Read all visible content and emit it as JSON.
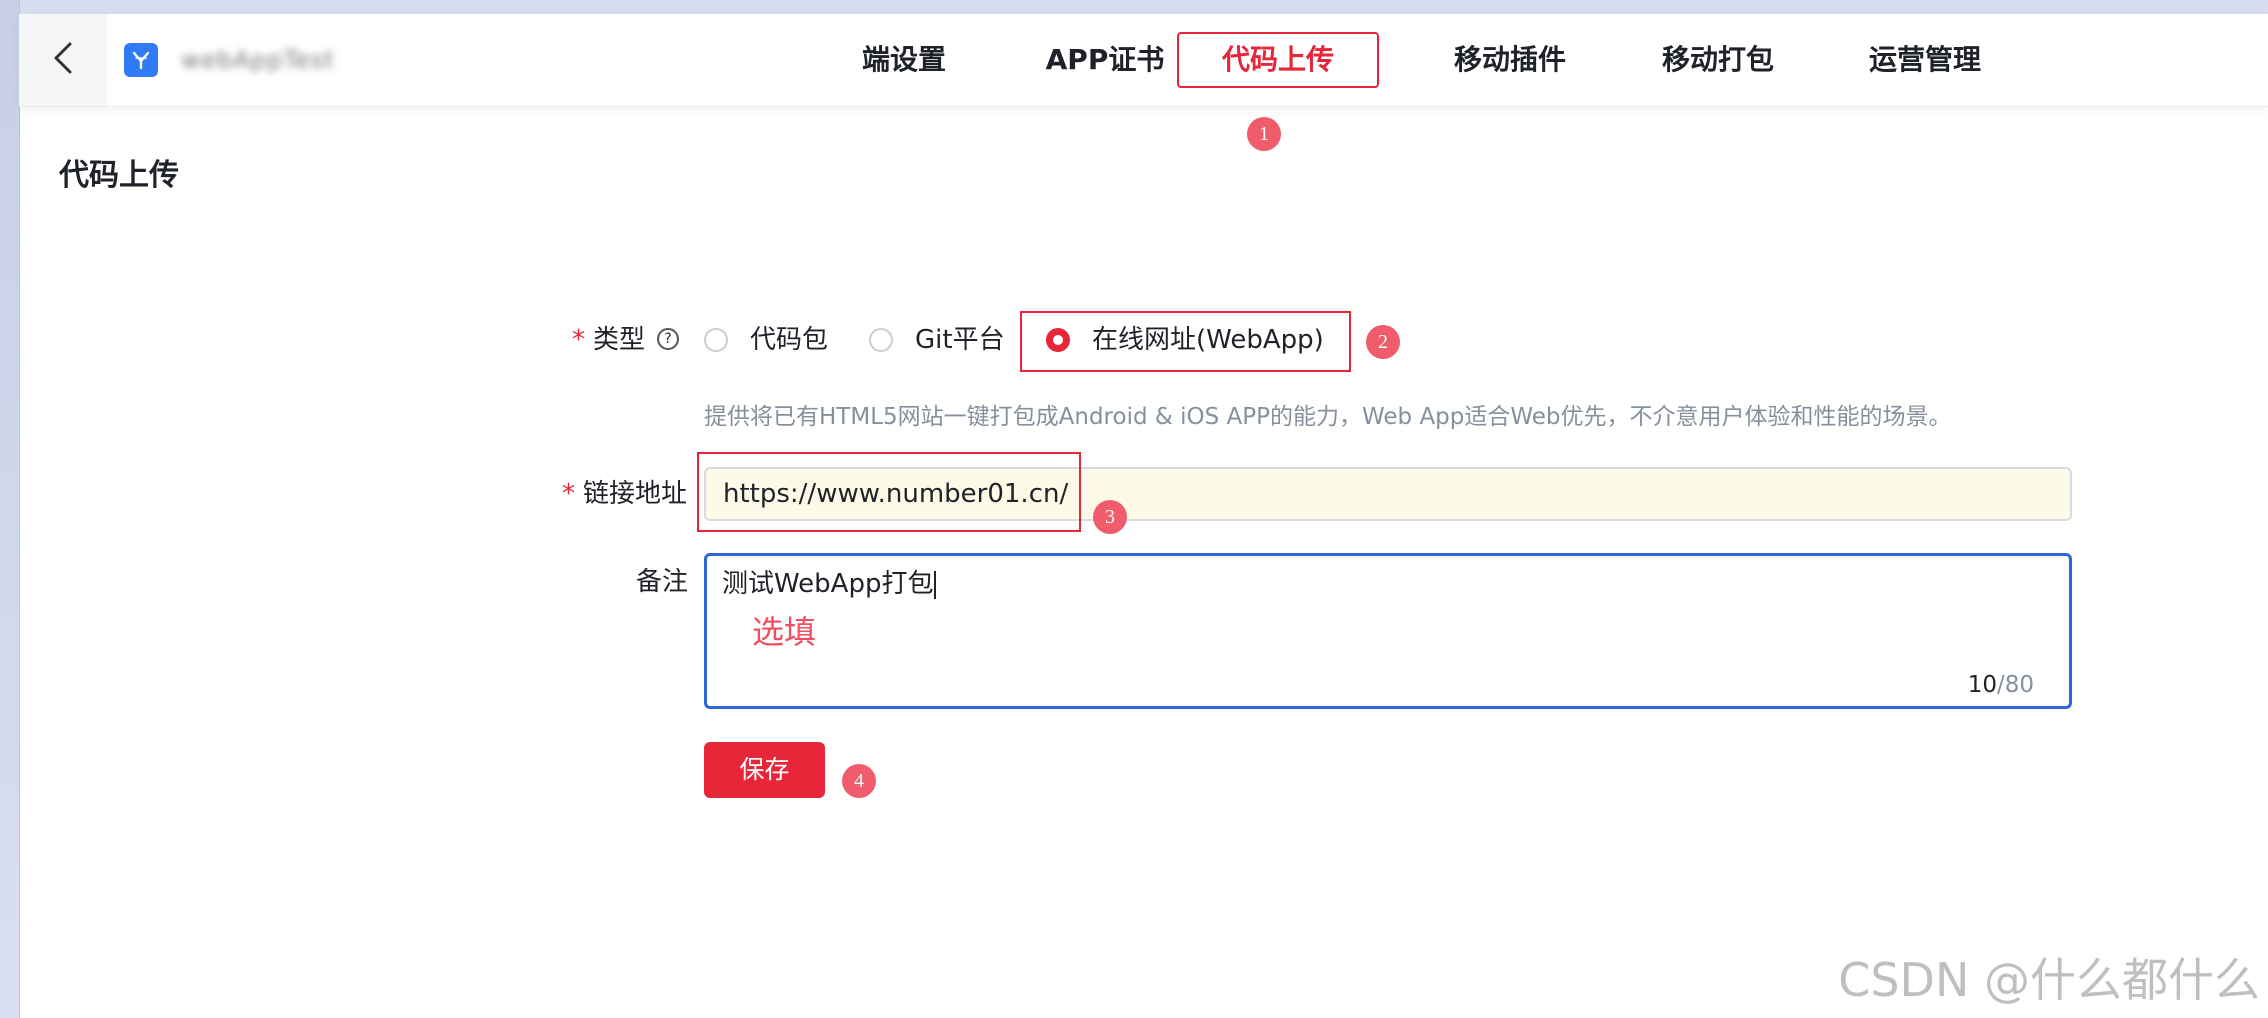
{
  "header": {
    "app_name": "webAppTest",
    "nav": [
      {
        "label": "端设置",
        "active": false
      },
      {
        "label": "APP证书",
        "active": false
      },
      {
        "label": "代码上传",
        "active": true
      },
      {
        "label": "移动插件",
        "active": false
      },
      {
        "label": "移动打包",
        "active": false
      },
      {
        "label": "运营管理",
        "active": false
      }
    ],
    "back_icon": "chevron-left-icon",
    "logo_icon": "app-logo-icon"
  },
  "page": {
    "title": "代码上传"
  },
  "form": {
    "type_label": "类型",
    "type_required": "*",
    "type_help_icon": "question-circle-icon",
    "type_options": [
      {
        "label": "代码包",
        "checked": false
      },
      {
        "label": "Git平台",
        "checked": false
      },
      {
        "label": "在线网址(WebApp)",
        "checked": true
      }
    ],
    "type_hint": "提供将已有HTML5网站一键打包成Android & iOS APP的能力，Web App适合Web优先，不介意用户体验和性能的场景。",
    "url_label": "链接地址",
    "url_required": "*",
    "url_value": "https://www.number01.cn/",
    "note_label": "备注",
    "note_value": "测试WebApp打包",
    "note_count": "10",
    "note_max": "/80",
    "optional_annotation": "选填",
    "save_label": "保存"
  },
  "markers": [
    "1",
    "2",
    "3",
    "4"
  ],
  "watermark": "CSDN @什么都什么",
  "colors": {
    "accent": "#e8263a",
    "marker": "#f05c6b",
    "focus_border": "#2e68d8",
    "url_bg": "#fdfbe8",
    "hint_text": "#86909c"
  }
}
